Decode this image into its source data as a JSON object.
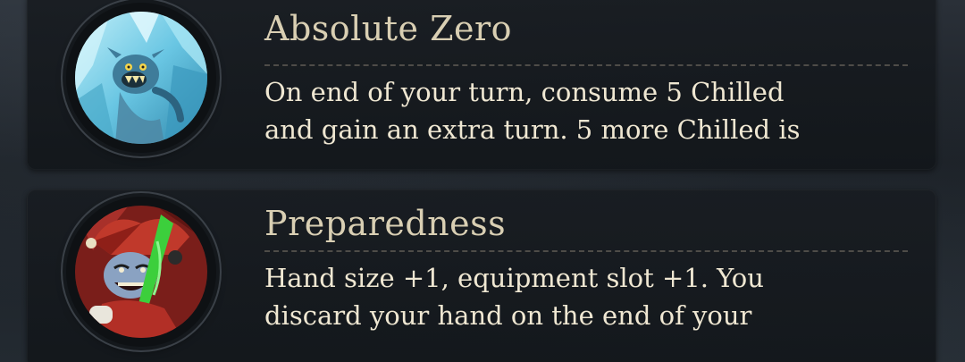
{
  "perks": [
    {
      "title": "Absolute Zero",
      "description_lines": [
        "On end of your turn, consume 5 Chilled",
        "and gain an extra turn. 5 more Chilled is"
      ],
      "portrait_icon": "frozen-monster-portrait-icon"
    },
    {
      "title": "Preparedness",
      "description_lines": [
        "Hand size +1, equipment slot +1. You",
        "discard your hand on the end of your"
      ],
      "portrait_icon": "jester-portrait-icon"
    }
  ],
  "colors": {
    "title": "#d9cfb3",
    "description": "#efe7d2",
    "card_bg": "#181c21",
    "ice": "#7fd3ea",
    "jester_red": "#c0392b",
    "jester_green": "#3ccf3c"
  }
}
